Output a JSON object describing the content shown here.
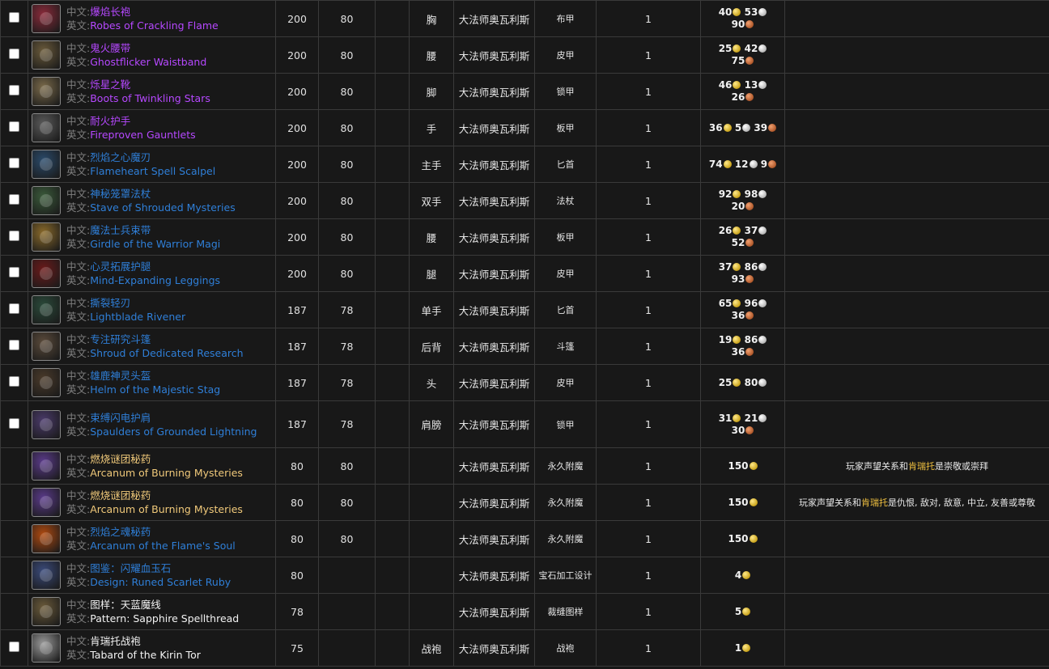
{
  "row_label_cn": "中文:",
  "row_label_en": "英文:",
  "accent_colors": {
    "epic": "#b648ff",
    "rare": "#2f7fd8",
    "common": "#f2f2f2",
    "highlight": "#f0c040"
  },
  "rows": [
    {
      "checkbox": true,
      "icon": "robe-icon",
      "icon_color": "#8a2a3a",
      "quality": "epic",
      "cn": "爆焰长袍",
      "en": "Robes of Crackling Flame",
      "item_level": "200",
      "req_level": "80",
      "slot": "胸",
      "source": "大法师奥瓦利斯",
      "type": "布甲",
      "count": "1",
      "price": [
        [
          {
            "v": "40",
            "c": "g"
          },
          {
            "v": "53",
            "c": "s"
          }
        ],
        [
          {
            "v": "90",
            "c": "c"
          }
        ]
      ],
      "note": ""
    },
    {
      "checkbox": true,
      "icon": "waistband-icon",
      "icon_color": "#6a5a3a",
      "quality": "epic",
      "cn": "鬼火腰带",
      "en": "Ghostflicker Waistband",
      "item_level": "200",
      "req_level": "80",
      "slot": "腰",
      "source": "大法师奥瓦利斯",
      "type": "皮甲",
      "count": "1",
      "price": [
        [
          {
            "v": "25",
            "c": "g"
          },
          {
            "v": "42",
            "c": "s"
          }
        ],
        [
          {
            "v": "75",
            "c": "c"
          }
        ]
      ],
      "note": ""
    },
    {
      "checkbox": true,
      "icon": "boots-icon",
      "icon_color": "#7a6a4a",
      "quality": "epic",
      "cn": "烁星之靴",
      "en": "Boots of Twinkling Stars",
      "item_level": "200",
      "req_level": "80",
      "slot": "脚",
      "source": "大法师奥瓦利斯",
      "type": "锁甲",
      "count": "1",
      "price": [
        [
          {
            "v": "46",
            "c": "g"
          },
          {
            "v": "13",
            "c": "s"
          }
        ],
        [
          {
            "v": "26",
            "c": "c"
          }
        ]
      ],
      "note": ""
    },
    {
      "checkbox": true,
      "icon": "gauntlets-icon",
      "icon_color": "#5a5a5a",
      "quality": "epic",
      "cn": "耐火护手",
      "en": "Fireproven Gauntlets",
      "item_level": "200",
      "req_level": "80",
      "slot": "手",
      "source": "大法师奥瓦利斯",
      "type": "板甲",
      "count": "1",
      "price": [
        [
          {
            "v": "36",
            "c": "g"
          },
          {
            "v": "5",
            "c": "s"
          },
          {
            "v": "39",
            "c": "c"
          }
        ]
      ],
      "note": ""
    },
    {
      "checkbox": true,
      "icon": "scalpel-icon",
      "icon_color": "#2a4a6a",
      "quality": "rare",
      "cn": "烈焰之心魔刃",
      "en": "Flameheart Spell Scalpel",
      "item_level": "200",
      "req_level": "80",
      "slot": "主手",
      "source": "大法师奥瓦利斯",
      "type": "匕首",
      "count": "1",
      "price": [
        [
          {
            "v": "74",
            "c": "g"
          },
          {
            "v": "12",
            "c": "s"
          },
          {
            "v": "9",
            "c": "c"
          }
        ]
      ],
      "note": ""
    },
    {
      "checkbox": true,
      "icon": "staff-icon",
      "icon_color": "#3a5a3a",
      "quality": "rare",
      "cn": "神秘笼罩法杖",
      "en": "Stave of Shrouded Mysteries",
      "item_level": "200",
      "req_level": "80",
      "slot": "双手",
      "source": "大法师奥瓦利斯",
      "type": "法杖",
      "count": "1",
      "price": [
        [
          {
            "v": "92",
            "c": "g"
          },
          {
            "v": "98",
            "c": "s"
          }
        ],
        [
          {
            "v": "20",
            "c": "c"
          }
        ]
      ],
      "note": ""
    },
    {
      "checkbox": true,
      "icon": "girdle-icon",
      "icon_color": "#8a6a2a",
      "quality": "rare",
      "cn": "魔法士兵束带",
      "en": "Girdle of the Warrior Magi",
      "item_level": "200",
      "req_level": "80",
      "slot": "腰",
      "source": "大法师奥瓦利斯",
      "type": "板甲",
      "count": "1",
      "price": [
        [
          {
            "v": "26",
            "c": "g"
          },
          {
            "v": "37",
            "c": "s"
          }
        ],
        [
          {
            "v": "52",
            "c": "c"
          }
        ]
      ],
      "note": ""
    },
    {
      "checkbox": true,
      "icon": "leggings-icon",
      "icon_color": "#6a1a1a",
      "quality": "rare",
      "cn": "心灵拓展护腿",
      "en": "Mind-Expanding Leggings",
      "item_level": "200",
      "req_level": "80",
      "slot": "腿",
      "source": "大法师奥瓦利斯",
      "type": "皮甲",
      "count": "1",
      "price": [
        [
          {
            "v": "37",
            "c": "g"
          },
          {
            "v": "86",
            "c": "s"
          }
        ],
        [
          {
            "v": "93",
            "c": "c"
          }
        ]
      ],
      "note": ""
    },
    {
      "checkbox": true,
      "icon": "dagger-icon",
      "icon_color": "#2a4a3a",
      "quality": "rare",
      "cn": "撕裂轻刃",
      "en": "Lightblade Rivener",
      "item_level": "187",
      "req_level": "78",
      "slot": "单手",
      "source": "大法师奥瓦利斯",
      "type": "匕首",
      "count": "1",
      "price": [
        [
          {
            "v": "65",
            "c": "g"
          },
          {
            "v": "96",
            "c": "s"
          }
        ],
        [
          {
            "v": "36",
            "c": "c"
          }
        ]
      ],
      "note": ""
    },
    {
      "checkbox": true,
      "icon": "cloak-icon",
      "icon_color": "#5a4a3a",
      "quality": "rare",
      "cn": "专注研究斗篷",
      "en": "Shroud of Dedicated Research",
      "item_level": "187",
      "req_level": "78",
      "slot": "后背",
      "source": "大法师奥瓦利斯",
      "type": "斗篷",
      "count": "1",
      "price": [
        [
          {
            "v": "19",
            "c": "g"
          },
          {
            "v": "86",
            "c": "s"
          }
        ],
        [
          {
            "v": "36",
            "c": "c"
          }
        ]
      ],
      "note": ""
    },
    {
      "checkbox": true,
      "icon": "helm-icon",
      "icon_color": "#4a3a2a",
      "quality": "rare",
      "cn": "雄鹿神灵头盔",
      "en": "Helm of the Majestic Stag",
      "item_level": "187",
      "req_level": "78",
      "slot": "头",
      "source": "大法师奥瓦利斯",
      "type": "皮甲",
      "count": "1",
      "price": [
        [
          {
            "v": "25",
            "c": "g"
          },
          {
            "v": "80",
            "c": "s"
          }
        ]
      ],
      "note": ""
    },
    {
      "checkbox": true,
      "icon": "spaulders-icon",
      "icon_color": "#4a3a6a",
      "quality": "rare",
      "cn": "束缚闪电护肩",
      "en": "Spaulders of Grounded Lightning",
      "item_level": "187",
      "req_level": "78",
      "slot": "肩膀",
      "source": "大法师奥瓦利斯",
      "type": "锁甲",
      "count": "1",
      "price": [
        [
          {
            "v": "31",
            "c": "g"
          },
          {
            "v": "21",
            "c": "s"
          }
        ],
        [
          {
            "v": "30",
            "c": "c"
          }
        ]
      ],
      "note": ""
    },
    {
      "checkbox": false,
      "icon": "arcanum-icon",
      "icon_color": "#5a3a8a",
      "quality": "gold",
      "cn": "燃烧谜团秘药",
      "en": "Arcanum of Burning Mysteries",
      "item_level": "80",
      "req_level": "80",
      "slot": "",
      "source": "大法师奥瓦利斯",
      "type": "永久附魔",
      "count": "1",
      "price": [
        [
          {
            "v": "150",
            "c": "g"
          }
        ]
      ],
      "note": {
        "a": "玩家声望关系和",
        "b": "肯瑞托",
        "c": "是崇敬或崇拜"
      }
    },
    {
      "checkbox": false,
      "icon": "arcanum-icon",
      "icon_color": "#5a3a8a",
      "quality": "gold",
      "cn": "燃烧谜团秘药",
      "en": "Arcanum of Burning Mysteries",
      "item_level": "80",
      "req_level": "80",
      "slot": "",
      "source": "大法师奥瓦利斯",
      "type": "永久附魔",
      "count": "1",
      "price": [
        [
          {
            "v": "150",
            "c": "g"
          }
        ]
      ],
      "note": {
        "a": "玩家声望关系和",
        "b": "肯瑞托",
        "c": "是仇恨, 敌对, 敌意, 中立, 友善或尊敬"
      }
    },
    {
      "checkbox": false,
      "icon": "flame-soul-icon",
      "icon_color": "#b04a10",
      "quality": "rare",
      "cn": "烈焰之魂秘药",
      "en": "Arcanum of the Flame's Soul",
      "item_level": "80",
      "req_level": "80",
      "slot": "",
      "source": "大法师奥瓦利斯",
      "type": "永久附魔",
      "count": "1",
      "price": [
        [
          {
            "v": "150",
            "c": "g"
          }
        ]
      ],
      "note": ""
    },
    {
      "checkbox": false,
      "icon": "scroll-icon",
      "icon_color": "#3a4a7a",
      "quality": "rare",
      "cn": "图鉴：闪耀血玉石",
      "en": "Design: Runed Scarlet Ruby",
      "item_level": "80",
      "req_level": "",
      "slot": "",
      "source": "大法师奥瓦利斯",
      "type": "宝石加工设计",
      "count": "1",
      "price": [
        [
          {
            "v": "4",
            "c": "g"
          }
        ]
      ],
      "note": ""
    },
    {
      "checkbox": false,
      "icon": "pattern-icon",
      "icon_color": "#6a5a3a",
      "quality": "common",
      "cn": "图样：天蓝魔线",
      "en": "Pattern: Sapphire Spellthread",
      "item_level": "78",
      "req_level": "",
      "slot": "",
      "source": "大法师奥瓦利斯",
      "type": "裁缝图样",
      "count": "1",
      "price": [
        [
          {
            "v": "5",
            "c": "g"
          }
        ]
      ],
      "note": ""
    },
    {
      "checkbox": true,
      "icon": "tabard-icon",
      "icon_color": "#9a9a9a",
      "quality": "common",
      "cn": "肯瑞托战袍",
      "en": "Tabard of the Kirin Tor",
      "item_level": "75",
      "req_level": "",
      "slot": "战袍",
      "source": "大法师奥瓦利斯",
      "type": "战袍",
      "count": "1",
      "price": [
        [
          {
            "v": "1",
            "c": "g"
          }
        ]
      ],
      "note": ""
    }
  ]
}
